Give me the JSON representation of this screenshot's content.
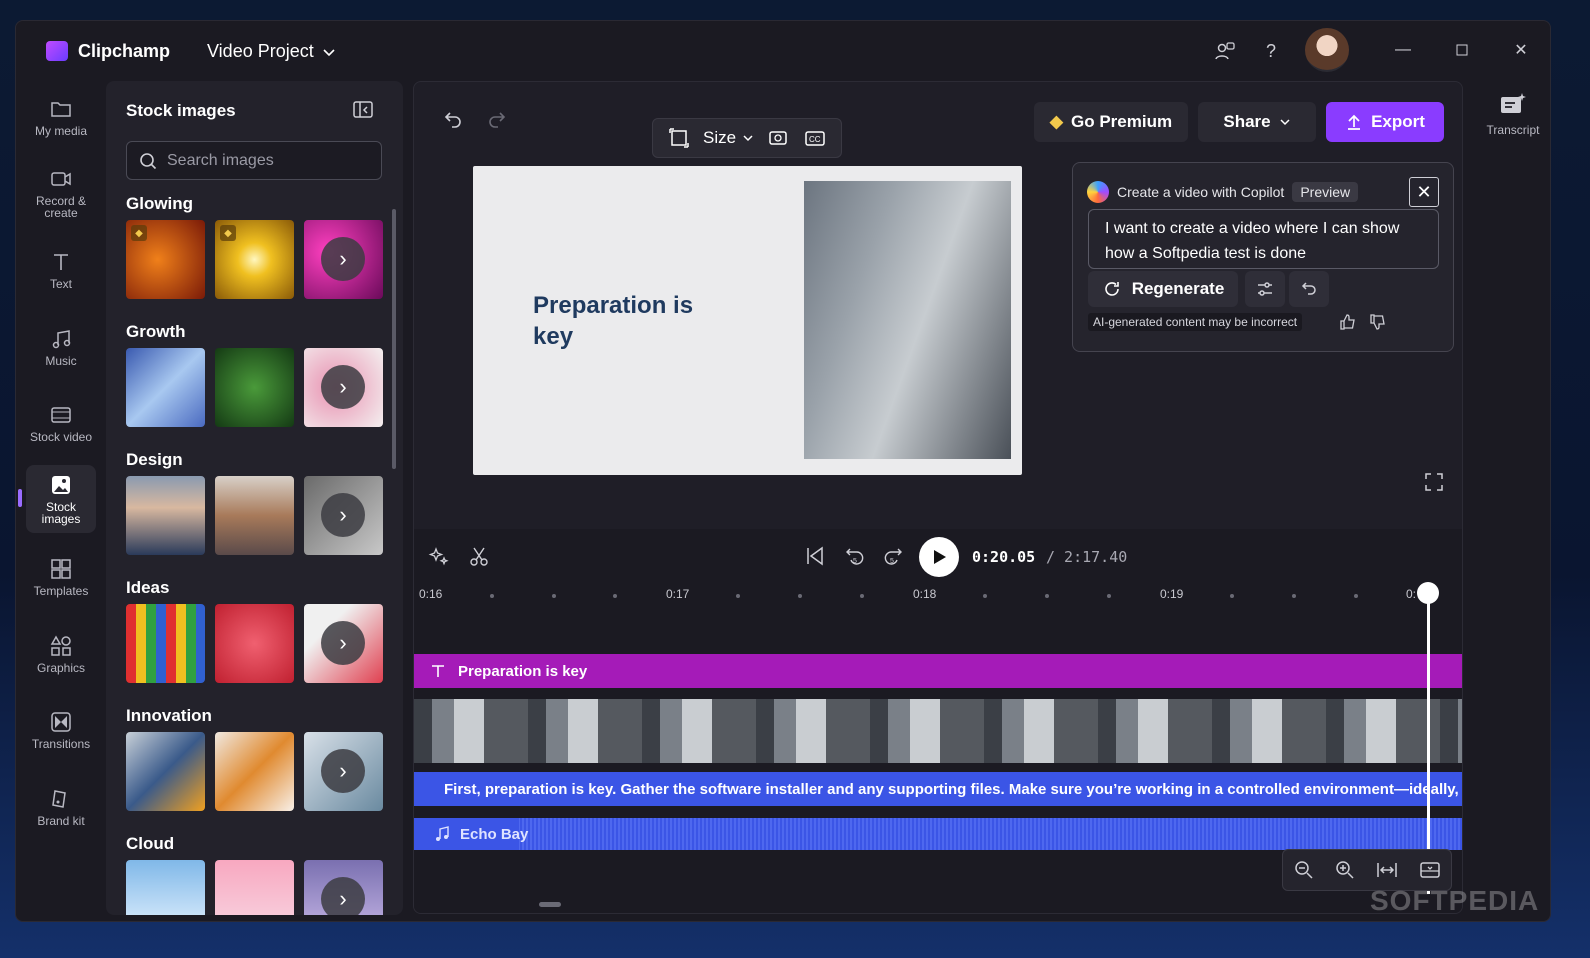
{
  "app": {
    "name": "Clipchamp",
    "project_title": "Video Project"
  },
  "nav": [
    {
      "label": "My media",
      "icon": "folder-icon"
    },
    {
      "label": "Record & create",
      "icon": "camera-icon"
    },
    {
      "label": "Text",
      "icon": "text-icon"
    },
    {
      "label": "Music",
      "icon": "music-icon"
    },
    {
      "label": "Stock video",
      "icon": "film-icon"
    },
    {
      "label": "Stock images",
      "icon": "image-icon",
      "active": true
    },
    {
      "label": "Templates",
      "icon": "templates-icon"
    },
    {
      "label": "Graphics",
      "icon": "shapes-icon"
    },
    {
      "label": "Transitions",
      "icon": "transitions-icon"
    },
    {
      "label": "Brand kit",
      "icon": "brand-kit-icon"
    }
  ],
  "stock": {
    "title": "Stock images",
    "search_placeholder": "Search images",
    "categories": [
      {
        "name": "Glowing",
        "colors": [
          "#c0441a",
          "#f0c020",
          "#c02080"
        ]
      },
      {
        "name": "Growth",
        "colors": [
          "#6b9ad6",
          "#2e6b2e",
          "#e8a0b8"
        ]
      },
      {
        "name": "Design",
        "colors": [
          "#4a6a8a",
          "#8a7a6a",
          "#9a9a9a"
        ]
      },
      {
        "name": "Ideas",
        "colors": [
          "#3aa04a",
          "#e04050",
          "#e05060"
        ]
      },
      {
        "name": "Innovation",
        "colors": [
          "#3a5a8a",
          "#e08a30",
          "#6a8aa0"
        ]
      },
      {
        "name": "Cloud",
        "colors": [
          "#a0c8e8",
          "#f0b0c8",
          "#8a80b8"
        ]
      }
    ]
  },
  "toolbar": {
    "size_label": "Size",
    "premium_label": "Go Premium",
    "share_label": "Share",
    "export_label": "Export"
  },
  "canvas": {
    "title": "Preparation is key"
  },
  "copilot": {
    "title": "Create a video with Copilot",
    "badge": "Preview",
    "prompt": "I want to create a video where I can show how a Softpedia test is done",
    "regenerate_label": "Regenerate",
    "disclaimer": "AI-generated content may be incorrect"
  },
  "playback": {
    "current_time": "0:20.05",
    "total_time": "/ 2:17.40"
  },
  "ruler": {
    "labels": [
      "0:16",
      "0:17",
      "0:18",
      "0:19",
      "0:"
    ]
  },
  "tracks": {
    "text_label": "Preparation is key",
    "voice_label": "First, preparation is key. Gather the software installer and any supporting files. Make sure you’re working in a controlled environment—ideally, a fresh",
    "audio_label": "Echo Bay"
  },
  "right_panel": {
    "label": "Transcript"
  },
  "watermark": "SOFTPEDIA",
  "colors": {
    "accent": "#8a3cff",
    "text_track": "#a51bb8",
    "voice_track": "#3b55e6"
  }
}
